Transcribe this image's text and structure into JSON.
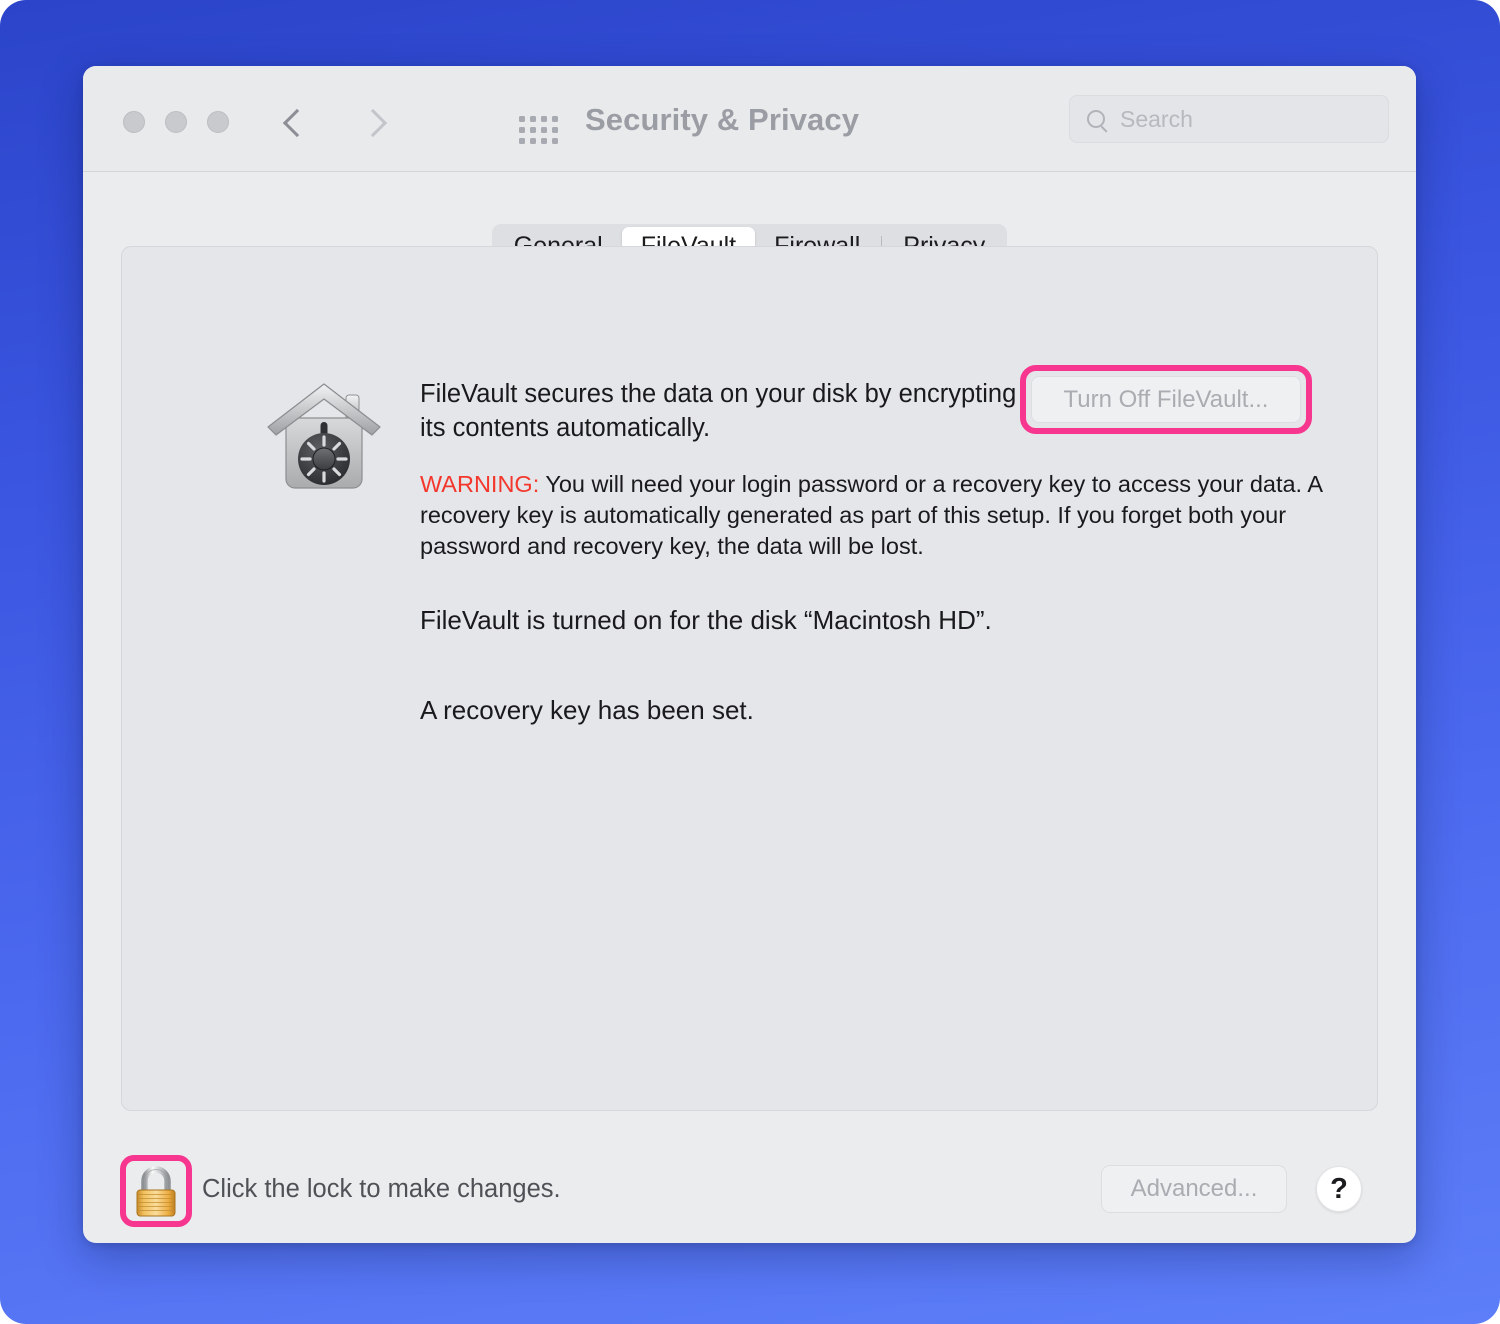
{
  "window": {
    "title": "Security & Privacy",
    "traffic_lights": [
      "close",
      "minimize",
      "zoom"
    ],
    "nav": {
      "back_icon": "chevron-left-icon",
      "forward_icon": "chevron-right-icon"
    },
    "grid_icon": "show-all-grid-icon",
    "search": {
      "placeholder": "Search",
      "value": "",
      "icon": "search-icon"
    }
  },
  "tabs": [
    {
      "label": "General",
      "active": false
    },
    {
      "label": "FileVault",
      "active": true
    },
    {
      "label": "Firewall",
      "active": false
    },
    {
      "label": "Privacy",
      "active": false
    }
  ],
  "filevault": {
    "icon": "filevault-house-safe-icon",
    "description": "FileVault secures the data on your disk by encrypting its contents automatically.",
    "warning_label": "WARNING:",
    "warning_text": " You will need your login password or a recovery key to access your data. A recovery key is automatically generated as part of this setup. If you forget both your password and recovery key, the data will be lost.",
    "status_disk": "FileVault is turned on for the disk “Macintosh HD”.",
    "status_key": "A recovery key has been set.",
    "turn_off_button": "Turn Off FileVault...",
    "turn_off_enabled": false
  },
  "bottom": {
    "lock_icon": "locked-padlock-icon",
    "lock_label": "Click the lock to make changes.",
    "advanced_button": "Advanced...",
    "advanced_enabled": false,
    "help_button": "?"
  },
  "colors": {
    "desktop_gradient_top": "#2b44c9",
    "desktop_gradient_bottom": "#5d7ef8",
    "window_bg": "#ebecee",
    "panel_bg": "#e4e6e9",
    "highlight_pink": "#f7378f",
    "warning_red": "#f4372c",
    "title_gray": "#9a9da3",
    "disabled_text": "#a9acb1"
  }
}
